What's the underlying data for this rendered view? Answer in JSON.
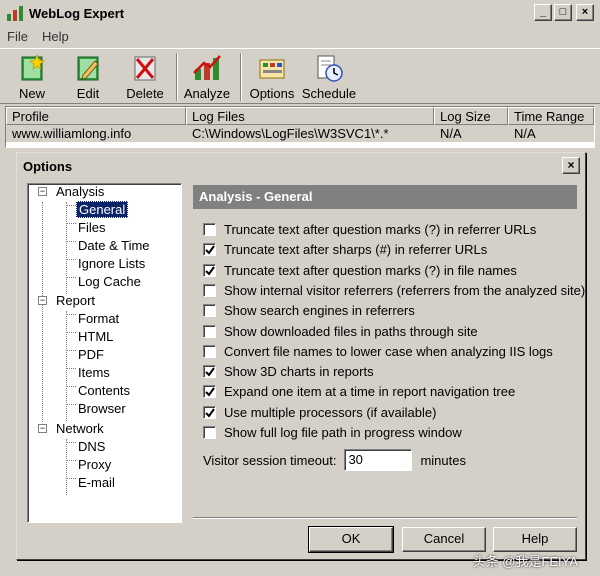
{
  "app": {
    "title": "WebLog Expert",
    "window_buttons": {
      "minimize": "_",
      "maximize": "□",
      "close": "×"
    }
  },
  "menu": [
    {
      "label": "File"
    },
    {
      "label": "Help"
    }
  ],
  "toolbar": {
    "new": "New",
    "edit": "Edit",
    "delete": "Delete",
    "analyze": "Analyze",
    "options": "Options",
    "schedule": "Schedule"
  },
  "profiles": {
    "columns": [
      "Profile",
      "Log Files",
      "Log Size",
      "Time Range"
    ],
    "rows": [
      {
        "profile": "www.williamlong.info",
        "log_files": "C:\\Windows\\LogFiles\\W3SVC1\\*.*",
        "log_size": "N/A",
        "time_range": "N/A"
      }
    ]
  },
  "options_dialog": {
    "title": "Options",
    "close": "×",
    "tree": {
      "analysis": "Analysis",
      "general": "General",
      "files": "Files",
      "date_time": "Date & Time",
      "ignore_lists": "Ignore Lists",
      "log_cache": "Log Cache",
      "report": "Report",
      "format": "Format",
      "html": "HTML",
      "pdf": "PDF",
      "items": "Items",
      "contents": "Contents",
      "browser": "Browser",
      "network": "Network",
      "dns": "DNS",
      "proxy": "Proxy",
      "email": "E-mail",
      "selected": "General"
    },
    "panel_title": "Analysis - General",
    "options": [
      {
        "label": "Truncate text after question marks (?) in referrer URLs",
        "checked": false
      },
      {
        "label": "Truncate text after sharps (#) in referrer URLs",
        "checked": true
      },
      {
        "label": "Truncate text after question marks (?) in file names",
        "checked": true
      },
      {
        "label": "Show internal visitor referrers (referrers from the analyzed site)",
        "checked": false
      },
      {
        "label": "Show search engines in referrers",
        "checked": false
      },
      {
        "label": "Show downloaded files in paths through site",
        "checked": false
      },
      {
        "label": "Convert file names to lower case when analyzing IIS logs",
        "checked": false
      },
      {
        "label": "Show 3D charts in reports",
        "checked": true
      },
      {
        "label": "Expand one item at a time in report navigation tree",
        "checked": true
      },
      {
        "label": "Use multiple processors (if available)",
        "checked": true
      },
      {
        "label": "Show full log file path in progress window",
        "checked": false
      }
    ],
    "timeout": {
      "label": "Visitor session timeout:",
      "value": "30",
      "unit": "minutes"
    },
    "buttons": {
      "ok": "OK",
      "cancel": "Cancel",
      "help": "Help"
    }
  },
  "watermark": "头条 @我是FEIYA"
}
